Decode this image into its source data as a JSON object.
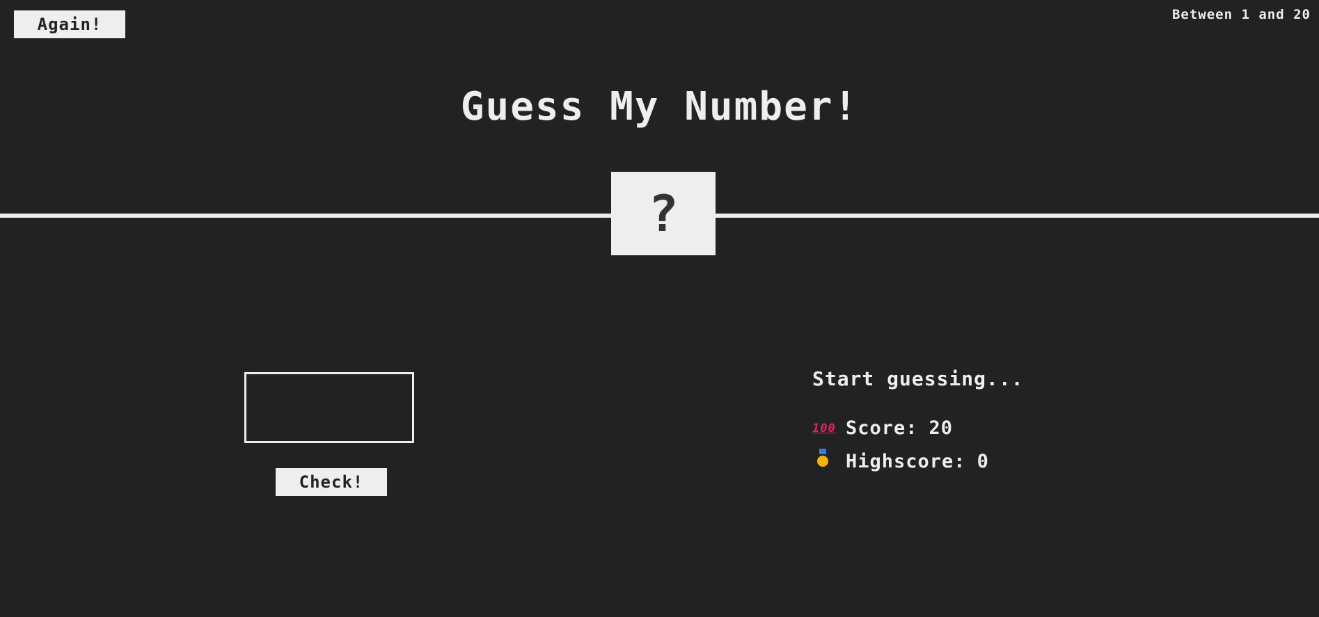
{
  "header": {
    "again_label": "Again!",
    "range_text": "Between 1 and 20"
  },
  "title": "Guess My Number!",
  "secret_number_display": "?",
  "guess": {
    "value": "",
    "placeholder": ""
  },
  "check_label": "Check!",
  "message": "Start guessing...",
  "stats": {
    "score_icon": "hundred-points-icon",
    "score_label": "Score:",
    "score_value": "20",
    "highscore_icon": "medal-icon",
    "highscore_label": "Highscore:",
    "highscore_value": "0"
  },
  "colors": {
    "background": "#222222",
    "foreground": "#eeeeee"
  }
}
